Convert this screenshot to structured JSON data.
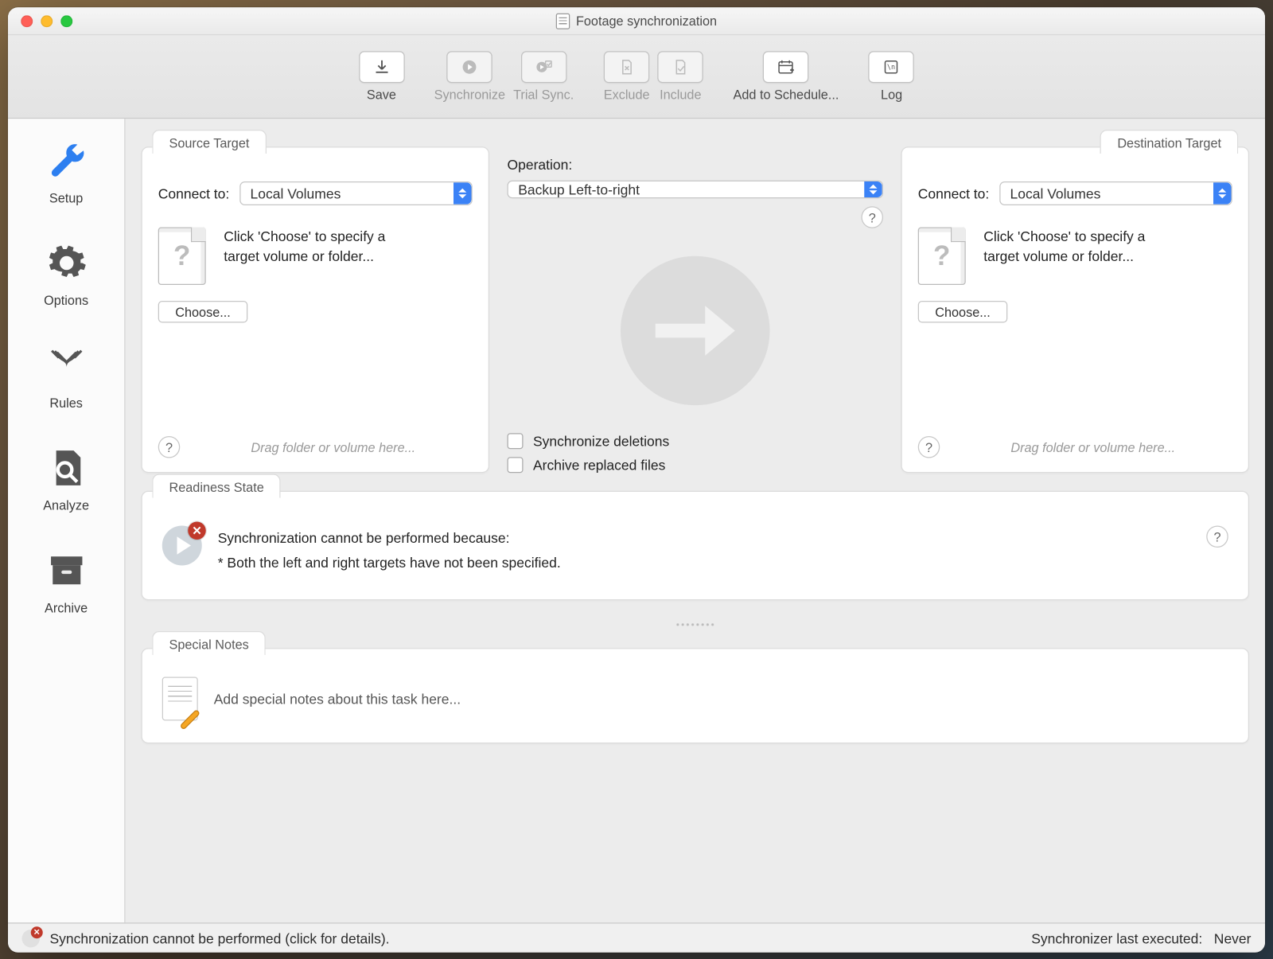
{
  "window": {
    "title": "Footage synchronization"
  },
  "toolbar": {
    "save": "Save",
    "synchronize": "Synchronize",
    "trial_sync": "Trial Sync.",
    "exclude": "Exclude",
    "include": "Include",
    "add_schedule": "Add to Schedule...",
    "log": "Log"
  },
  "sidebar": {
    "setup": "Setup",
    "options": "Options",
    "rules": "Rules",
    "analyze": "Analyze",
    "archive": "Archive"
  },
  "source": {
    "tab": "Source Target",
    "connect_label": "Connect to:",
    "connect_value": "Local Volumes",
    "hint": "Click 'Choose' to specify a target volume or folder...",
    "choose": "Choose...",
    "drag_hint": "Drag folder or volume here..."
  },
  "destination": {
    "tab": "Destination Target",
    "connect_label": "Connect to:",
    "connect_value": "Local Volumes",
    "hint": "Click 'Choose' to specify a target volume or folder...",
    "choose": "Choose...",
    "drag_hint": "Drag folder or volume here..."
  },
  "operation": {
    "label": "Operation:",
    "value": "Backup Left-to-right",
    "sync_deletions": "Synchronize deletions",
    "archive_replaced": "Archive replaced files"
  },
  "readiness": {
    "tab": "Readiness State",
    "line1": "Synchronization cannot be performed because:",
    "line2": "* Both the left and right targets have not been specified."
  },
  "notes": {
    "tab": "Special Notes",
    "placeholder": "Add special notes about this task here..."
  },
  "status": {
    "left": "Synchronization cannot be performed (click for details).",
    "right_label": "Synchronizer last executed:",
    "right_value": "Never"
  }
}
